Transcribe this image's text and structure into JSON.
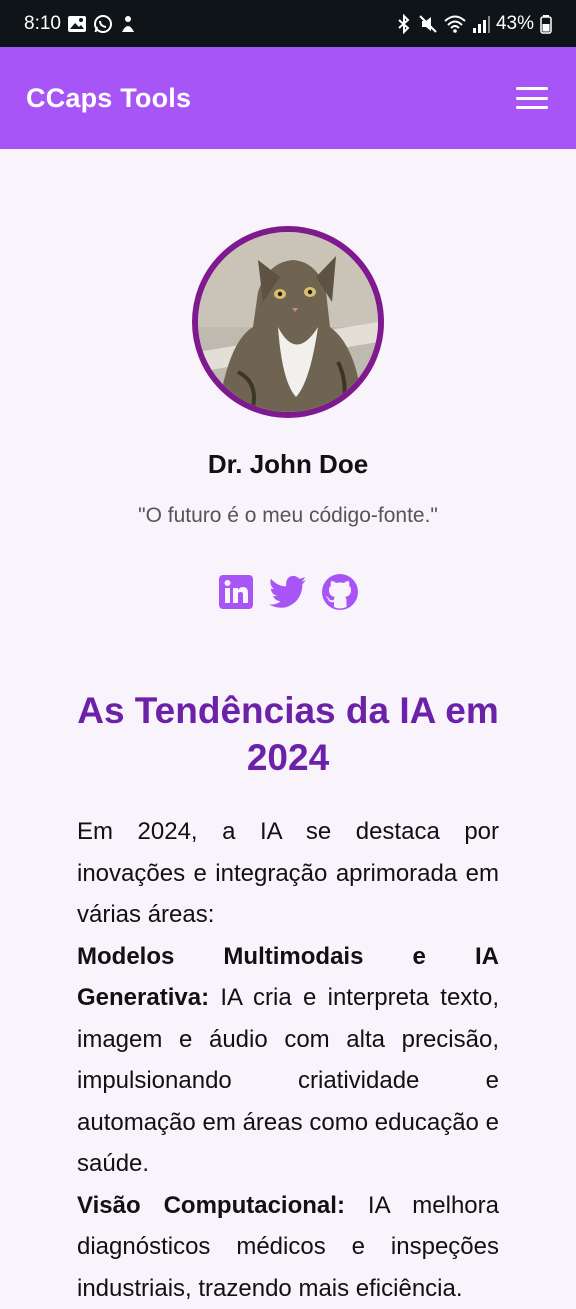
{
  "status_bar": {
    "time": "8:10",
    "battery": "43%"
  },
  "app_bar": {
    "brand": "CCaps Tools",
    "menu_icon": "hamburger-menu-icon"
  },
  "profile": {
    "name": "Dr. John Doe",
    "quote": "\"O futuro é o meu código-fonte.\"",
    "socials": [
      "linkedin-icon",
      "twitter-icon",
      "github-icon"
    ],
    "accent": "#a855f7"
  },
  "article": {
    "title": "As Tendências da IA em 2024",
    "intro": "Em 2024, a IA se destaca por inovações e integração aprimorada em várias áreas:",
    "sections": [
      {
        "heading": "Modelos Multimodais e IA Generativa:",
        "text": " IA cria e interpreta texto, imagem e áudio com alta precisão, impulsionando criatividade e automação em áreas como educação e saúde."
      },
      {
        "heading": "Visão Computacional:",
        "text": " IA melhora diagnósticos médicos e inspeções industriais, trazendo mais eficiência."
      }
    ]
  }
}
